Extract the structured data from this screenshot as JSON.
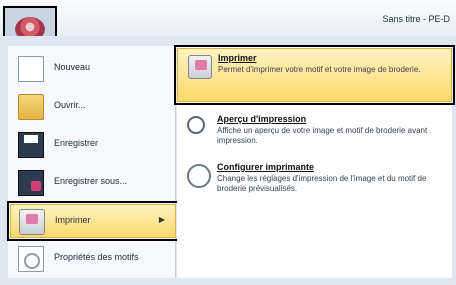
{
  "window": {
    "title": "Sans titre - PE-D"
  },
  "app_menu": {
    "left_items": [
      {
        "label": "Nouveau",
        "icon": "new-document-icon"
      },
      {
        "label": "Ouvrir...",
        "icon": "folder-open-icon"
      },
      {
        "label": "Enregistrer",
        "icon": "save-disk-icon"
      },
      {
        "label": "Enregistrer sous...",
        "icon": "save-as-icon"
      },
      {
        "label": "Imprimer",
        "icon": "printer-icon",
        "selected": true
      },
      {
        "label": "Propriétés des motifs",
        "icon": "properties-icon"
      }
    ],
    "submenu": [
      {
        "title": "Imprimer",
        "desc": "Permet d'imprimer votre motif et votre image de broderie.",
        "icon": "printer-icon"
      },
      {
        "title": "Aperçu d'impression",
        "desc": "Affiche un aperçu de votre image et motif de broderie avant impression.",
        "icon": "print-preview-icon"
      },
      {
        "title": "Configurer imprimante",
        "desc": "Change les réglages d'impression de l'image et du motif de broderie prévisualisés.",
        "icon": "printer-settings-icon"
      }
    ]
  },
  "colors": {
    "highlight_top": "#fff3c2",
    "highlight_bottom": "#ffd86a",
    "panel": "#dfe6ef"
  }
}
